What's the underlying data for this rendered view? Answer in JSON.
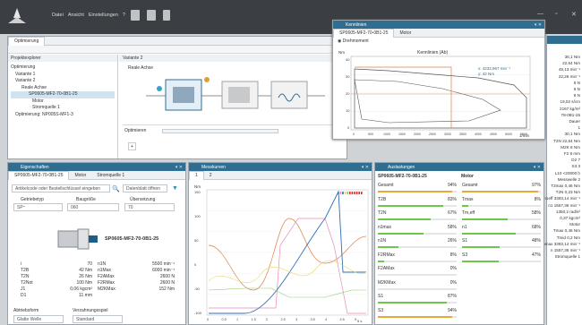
{
  "app": {
    "menu": [
      "Datei",
      "Ansicht",
      "Einstellungen",
      "?"
    ]
  },
  "optimierung": {
    "tab": "Optimierung",
    "left_title": "Projektexplorer",
    "right_title": "Variante 2",
    "tree": [
      "Optimierung",
      "Variante 1",
      "Variante 2",
      "Reale Achse",
      "SP0605-MF2-70-0B1-25",
      "Motor",
      "Stromquelle 1",
      "Optimierung: NP005S-MF1-3"
    ],
    "reale_achse": "Reale Achse",
    "optimieren_label": "Optimieren",
    "add": "+"
  },
  "kennlinien": {
    "title": "Kennlinien",
    "tabs": [
      "SP0605-MF2-70-0B1-25",
      "Motor"
    ],
    "option": "Drehmoment",
    "chart_title": "Kennlinien (Ab)",
    "ylabel": "Nm",
    "xlabel": "1/min",
    "readout": [
      "x: 4232,967 min⁻¹",
      "y: 42 Nm"
    ],
    "yticks": [
      "40",
      "30",
      "20",
      "10",
      "0"
    ],
    "xticks": [
      "0",
      "500",
      "1000",
      "1500",
      "2000",
      "2500",
      "3000",
      "3500",
      "4000",
      "4500",
      "5000",
      "5500"
    ]
  },
  "eigen": {
    "title": "Eigenschaften",
    "tabs": [
      "SP0605-MF2-70-0B1-25",
      "Motor",
      "Stromquelle 1"
    ],
    "search_placeholder": "Artikelcode oder Bestellschlüssel eingeben",
    "datasheet_btn": "Datenblatt öffnen",
    "labels": [
      "Getriebetyp",
      "Baugröße",
      "Übersetzung"
    ],
    "values": [
      "SP⁺",
      "060",
      "70"
    ],
    "product": "SP0605-MF2-70-0B1-25",
    "specs_left": [
      [
        "i",
        "70"
      ],
      [
        "T2B",
        "42 Nm"
      ],
      [
        "T2N",
        "26 Nm"
      ],
      [
        "T2Not",
        "100 Nm"
      ],
      [
        "J1",
        "0,06 kgcm²"
      ],
      [
        "D1",
        "11 mm"
      ]
    ],
    "specs_right": [
      [
        "n1N",
        "5500 min⁻¹"
      ],
      [
        "n1Max",
        "6000 min⁻¹"
      ],
      [
        "F2AMax",
        "2600 N"
      ],
      [
        "F2RMax",
        "2600 N"
      ],
      [
        "M2KMax",
        "152 Nm"
      ]
    ],
    "bottom_labels": [
      "Abtriebsform",
      "Verzahnungsspiel"
    ],
    "bottom_values": [
      "Glatte Welle",
      "Standard"
    ]
  },
  "messkurven": {
    "title": "Messkurven",
    "tabs": [
      "1",
      "2"
    ],
    "yticks": [
      "150",
      "100",
      "50",
      "0",
      "-50",
      "-100"
    ],
    "xticks": [
      "0",
      "0.5",
      "1",
      "1.5",
      "2",
      "2.5",
      "3",
      "3.5",
      "4",
      "4.5",
      "5"
    ],
    "xunit": "5 s",
    "ylabel": "Nm"
  },
  "auslastungen": {
    "title": "Auslastungen",
    "col1": "SP0605-MF2-70-0B1-25",
    "col2": "Motor",
    "rows": [
      [
        "Gesamt",
        "94%",
        "Gesamt",
        "97%"
      ],
      [
        "T2B",
        "83%",
        "Tmax",
        "8%"
      ],
      [
        "T2N",
        "67%",
        "Tm,eff",
        "58%"
      ],
      [
        "n1max",
        "58%",
        "n1",
        "68%"
      ],
      [
        "n1N",
        "26%",
        "S1",
        "48%"
      ],
      [
        "F2RMax",
        "8%",
        "S3",
        "47%"
      ],
      [
        "F2AMax",
        "0%",
        "",
        ""
      ],
      [
        "M2KMax",
        "0%",
        "",
        ""
      ],
      [
        "S1",
        "87%",
        "",
        ""
      ],
      [
        "S3",
        "94%",
        "",
        ""
      ]
    ],
    "fill1": [
      0.94,
      0.83,
      0.67,
      0.58,
      0.26,
      0.08,
      0,
      0,
      0.87,
      0.94
    ],
    "fill2": [
      0.97,
      0.08,
      0.58,
      0.68,
      0.48,
      0.47
    ]
  },
  "rightpanel": {
    "items": [
      [
        "",
        "36,1 Nm"
      ],
      [
        "",
        "22,64 Nm"
      ],
      [
        "",
        "49,13 min⁻¹"
      ],
      [
        "",
        "22,26 min⁻¹"
      ],
      [
        "",
        "8 N"
      ],
      [
        "",
        "8 N"
      ],
      [
        "",
        "8 N"
      ],
      [
        "",
        "19,02 s/cm"
      ],
      [
        "",
        "2167 kg/m²"
      ],
      [
        "78-0B1-25",
        ""
      ],
      [
        "Dauer",
        ""
      ],
      [
        "",
        "1"
      ],
      [
        "",
        "30,1 Nm"
      ],
      [
        "T2N",
        "22,64 Nm"
      ],
      [
        "M2K",
        "8 Nm"
      ],
      [
        "F2",
        "8 mm"
      ],
      [
        "D2",
        "7"
      ],
      [
        "S3",
        "3"
      ],
      [
        "L10",
        "<20000 h"
      ],
      [
        "Messwelle 2",
        ""
      ],
      [
        "T2max",
        "0,46 Nm"
      ],
      [
        "T2N",
        "0,23 Nm"
      ],
      [
        "n1eff",
        "3393,14 min⁻¹"
      ],
      [
        "n1",
        "1557,36 min⁻¹"
      ],
      [
        "",
        "1350,2 rad/s²"
      ],
      [
        "",
        "0,37 kgcm²"
      ],
      [
        "Motor",
        ""
      ],
      [
        "Tmax",
        "0,46 Nm"
      ],
      [
        "Tmid",
        "0,2 Nm"
      ],
      [
        "nmax",
        "3393,14 min⁻¹"
      ],
      [
        "n",
        "1557,36 min⁻¹"
      ],
      [
        "Stromquelle 1",
        ""
      ]
    ]
  }
}
